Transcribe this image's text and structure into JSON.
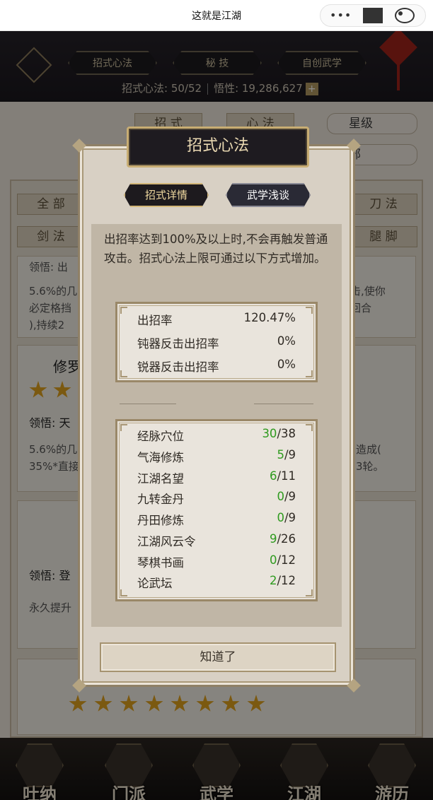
{
  "window": {
    "title": "这就是江湖"
  },
  "capsule": {
    "more_icon": "more-dots-icon",
    "minimize_icon": "minimize-icon",
    "close_icon": "record-close-icon"
  },
  "header": {
    "tabs": [
      "招式心法",
      "秘 技",
      "自创武学"
    ],
    "stat_line_1": "招式心法: 50/52",
    "stat_line_2": "悟性: 19,286,627"
  },
  "background": {
    "subtabs": [
      "招 式",
      "心 法"
    ],
    "sort_label": "星级",
    "filter_label": "部",
    "chips_row1": [
      "全 部",
      "刀 法"
    ],
    "chips_row2": [
      "剑 法",
      "腿 脚"
    ],
    "card1_line": "领悟: 出",
    "card1_text_1": "5.6%的几",
    "card1_text_2": "必定格挡",
    "card1_text_3": "),持续2",
    "card1_right_1": "击,使你",
    "card1_right_2": "回合",
    "card2_name": "修罗",
    "card2_line": "领悟: 天",
    "card2_text_1": "5.6%的几",
    "card2_text_2": "35%*直接",
    "card2_right_1": "造成(",
    "card2_right_2": "3轮。",
    "card3_line": "领悟: 登",
    "card3_text_1": "永久提升"
  },
  "bottom_nav": [
    "吐纳",
    "门派",
    "武学",
    "江湖",
    "游历"
  ],
  "dialog": {
    "title": "招式心法",
    "tabs": {
      "active": "招式详情",
      "inactive": "武学浅谈"
    },
    "description": "出招率达到100%及以上时,不会再触发普通攻击。招式心法上限可通过以下方式增加。",
    "rates": [
      {
        "label": "出招率",
        "value": "120.47%"
      },
      {
        "label": "钝器反击出招率",
        "value": "0%"
      },
      {
        "label": "锐器反击出招率",
        "value": "0%"
      }
    ],
    "sources": [
      {
        "label": "经脉穴位",
        "current": "30",
        "max": "/38"
      },
      {
        "label": "气海修炼",
        "current": "5",
        "max": "/9"
      },
      {
        "label": "江湖名望",
        "current": "6",
        "max": "/11"
      },
      {
        "label": "九转金丹",
        "current": "0",
        "max": "/9"
      },
      {
        "label": "丹田修炼",
        "current": "0",
        "max": "/9"
      },
      {
        "label": "江湖风云令",
        "current": "9",
        "max": "/26"
      },
      {
        "label": "琴棋书画",
        "current": "0",
        "max": "/12"
      },
      {
        "label": "论武坛",
        "current": "2",
        "max": "/12"
      }
    ],
    "confirm_label": "知道了"
  }
}
